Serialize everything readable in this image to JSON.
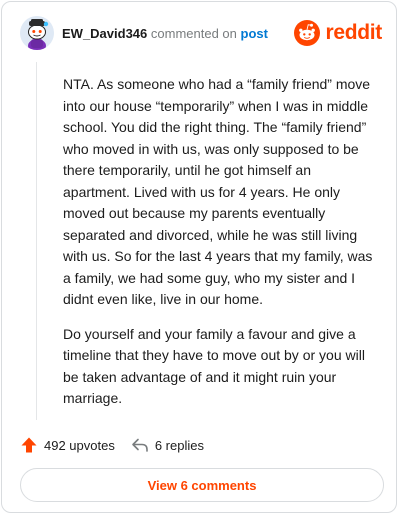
{
  "header": {
    "username": "EW_David346",
    "action_text": "commented on",
    "post_link": "post",
    "brand": "reddit"
  },
  "comment": {
    "paragraphs": [
      "NTA. As someone who had a “family friend” move into our house “temporarily” when I was in middle school. You did the right thing. The “family friend” who moved in with us, was only supposed to be there temporarily, until he got himself an apartment. Lived with us for 4 years. He only moved out because my parents eventually separated and divorced, while he was still living with us. So for the last 4 years that my family, was a family, we had some guy, who my sister and I didnt even like, live in our home.",
      "Do yourself and your family a favour and give a timeline that they have to move out by or you will be taken advantage of and it might ruin your marriage."
    ]
  },
  "actions": {
    "upvotes": "492 upvotes",
    "replies": "6 replies"
  },
  "footer": {
    "view_comments": "View 6 comments"
  },
  "colors": {
    "brand": "#ff4500",
    "link": "#0079d3",
    "muted": "#787c7e"
  }
}
